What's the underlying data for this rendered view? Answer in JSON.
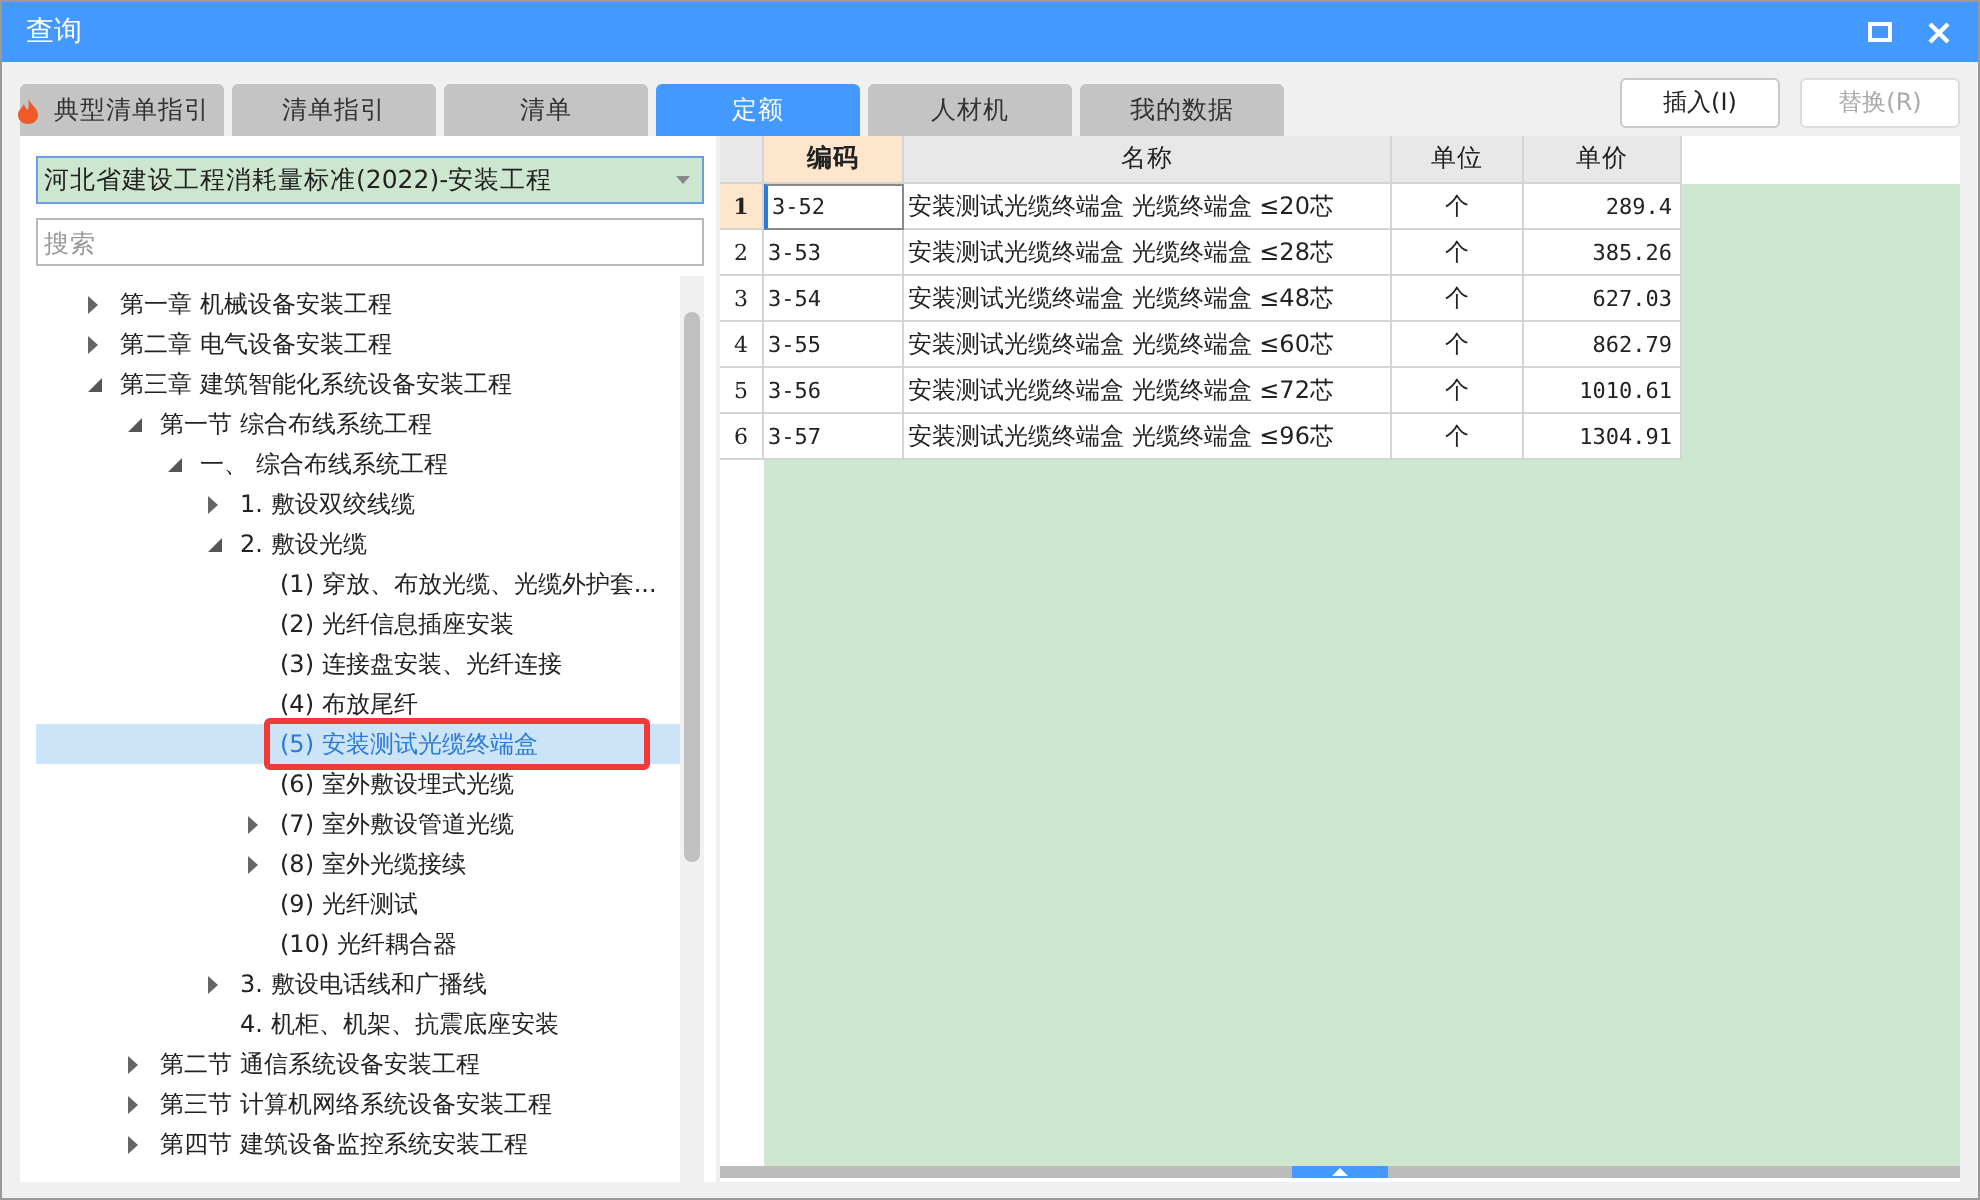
{
  "window": {
    "title": "查询"
  },
  "tabs": [
    {
      "label": "典型清单指引",
      "selected": false,
      "kind": "hot"
    },
    {
      "label": "清单指引",
      "selected": false,
      "kind": "plain"
    },
    {
      "label": "清单",
      "selected": false,
      "kind": "plain"
    },
    {
      "label": "定额",
      "selected": true,
      "kind": "plain"
    },
    {
      "label": "人材机",
      "selected": false,
      "kind": "plain"
    },
    {
      "label": "我的数据",
      "selected": false,
      "kind": "plain"
    }
  ],
  "buttons": [
    {
      "label": "插入(I)",
      "disabled": false
    },
    {
      "label": "替换(R)",
      "disabled": true
    }
  ],
  "library_select": {
    "value": "河北省建设工程消耗量标准(2022)-安装工程"
  },
  "search": {
    "placeholder": "搜索"
  },
  "tree": [
    {
      "label": "第一章 机械设备安装工程",
      "kind": "folder",
      "expanded": false,
      "selected": false
    },
    {
      "label": "第二章 电气设备安装工程",
      "kind": "folder",
      "expanded": false,
      "selected": false
    },
    {
      "label": "第三章 建筑智能化系统设备安装工程",
      "kind": "folder",
      "expanded": true,
      "selected": false,
      "children": [
        {
          "label": "第一节 综合布线系统工程",
          "kind": "folder",
          "expanded": true,
          "selected": false,
          "children": [
            {
              "label": "一、 综合布线系统工程",
              "kind": "folder",
              "expanded": true,
              "selected": false,
              "children": [
                {
                  "label": "1. 敷设双绞线缆",
                  "kind": "folder",
                  "expanded": false,
                  "selected": false
                },
                {
                  "label": "2. 敷设光缆",
                  "kind": "folder",
                  "expanded": true,
                  "selected": false,
                  "children": [
                    {
                      "label": "(1) 穿放、布放光缆、光缆外护套...",
                      "kind": "leaf",
                      "selected": false
                    },
                    {
                      "label": "(2) 光纤信息插座安装",
                      "kind": "leaf",
                      "selected": false
                    },
                    {
                      "label": "(3) 连接盘安装、光纤连接",
                      "kind": "leaf",
                      "selected": false
                    },
                    {
                      "label": "(4) 布放尾纤",
                      "kind": "leaf",
                      "selected": false
                    },
                    {
                      "label": "(5) 安装测试光缆终端盒",
                      "kind": "leaf",
                      "selected": true,
                      "highlighted": true
                    },
                    {
                      "label": "(6) 室外敷设埋式光缆",
                      "kind": "leaf",
                      "selected": false
                    },
                    {
                      "label": "(7) 室外敷设管道光缆",
                      "kind": "folder",
                      "expanded": false,
                      "selected": false
                    },
                    {
                      "label": "(8) 室外光缆接续",
                      "kind": "folder",
                      "expanded": false,
                      "selected": false
                    },
                    {
                      "label": "(9) 光纤测试",
                      "kind": "leaf",
                      "selected": false
                    },
                    {
                      "label": "(10) 光纤耦合器",
                      "kind": "leaf",
                      "selected": false
                    }
                  ]
                },
                {
                  "label": "3. 敷设电话线和广播线",
                  "kind": "folder",
                  "expanded": false,
                  "selected": false
                },
                {
                  "label": "4. 机柜、机架、抗震底座安装",
                  "kind": "leaf",
                  "selected": false
                }
              ]
            }
          ]
        },
        {
          "label": "第二节 通信系统设备安装工程",
          "kind": "folder",
          "expanded": false,
          "selected": false
        },
        {
          "label": "第三节 计算机网络系统设备安装工程",
          "kind": "folder",
          "expanded": false,
          "selected": false
        },
        {
          "label": "第四节 建筑设备监控系统安装工程",
          "kind": "folder",
          "expanded": false,
          "selected": false
        }
      ]
    }
  ],
  "table": {
    "columns": [
      {
        "label": "编码",
        "selected": true
      },
      {
        "label": "名称",
        "selected": false
      },
      {
        "label": "单位",
        "selected": false
      },
      {
        "label": "单价",
        "selected": false
      }
    ],
    "rows": [
      {
        "index": "1",
        "code": "3-52",
        "name": "安装测试光缆终端盒 光缆终端盒 ≤20芯",
        "unit": "个",
        "price": "289.4",
        "selected": true
      },
      {
        "index": "2",
        "code": "3-53",
        "name": "安装测试光缆终端盒 光缆终端盒 ≤28芯",
        "unit": "个",
        "price": "385.26",
        "selected": false
      },
      {
        "index": "3",
        "code": "3-54",
        "name": "安装测试光缆终端盒 光缆终端盒 ≤48芯",
        "unit": "个",
        "price": "627.03",
        "selected": false
      },
      {
        "index": "4",
        "code": "3-55",
        "name": "安装测试光缆终端盒 光缆终端盒 ≤60芯",
        "unit": "个",
        "price": "862.79",
        "selected": false
      },
      {
        "index": "5",
        "code": "3-56",
        "name": "安装测试光缆终端盒 光缆终端盒 ≤72芯",
        "unit": "个",
        "price": "1010.61",
        "selected": false
      },
      {
        "index": "6",
        "code": "3-57",
        "name": "安装测试光缆终端盒 光缆终端盒 ≤96芯",
        "unit": "个",
        "price": "1304.91",
        "selected": false
      }
    ]
  }
}
